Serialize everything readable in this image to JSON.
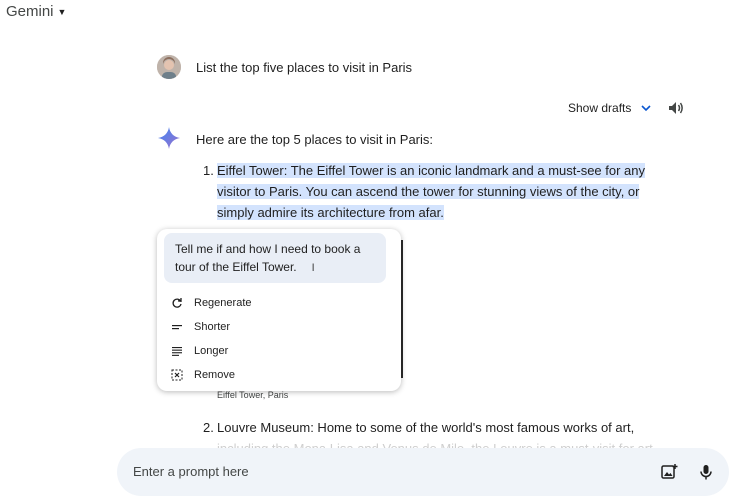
{
  "app": {
    "title": "Gemini"
  },
  "user_message": {
    "text": "List the top five places to visit in Paris"
  },
  "response": {
    "show_drafts_label": "Show drafts",
    "intro": "Here are the top 5 places to visit in Paris:",
    "items": [
      {
        "number": "1.",
        "text": "Eiffel Tower: The Eiffel Tower is an iconic landmark and a must-see for any visitor to Paris. You can ascend the tower for stunning views of the city, or simply admire its architecture from afar."
      },
      {
        "number": "2.",
        "text_line1": "Louvre Museum: Home to some of the world's most famous works of art,",
        "text_line2": "including the Mona Lisa and Venus de Milo, the Louvre is a must-visit for art"
      }
    ],
    "image_caption": "Eiffel Tower, Paris"
  },
  "modify_menu": {
    "input_text": "Tell me if and how I need to book a tour of the Eiffel Tower.",
    "options": [
      {
        "label": "Regenerate",
        "icon": "refresh-icon"
      },
      {
        "label": "Shorter",
        "icon": "short-lines-icon"
      },
      {
        "label": "Longer",
        "icon": "long-lines-icon"
      },
      {
        "label": "Remove",
        "icon": "remove-icon"
      }
    ]
  },
  "prompt": {
    "placeholder": "Enter a prompt here",
    "value": ""
  },
  "colors": {
    "highlight": "#d3e3fd",
    "accent": "#0b57d0",
    "prompt_bg": "#f0f4f9"
  }
}
